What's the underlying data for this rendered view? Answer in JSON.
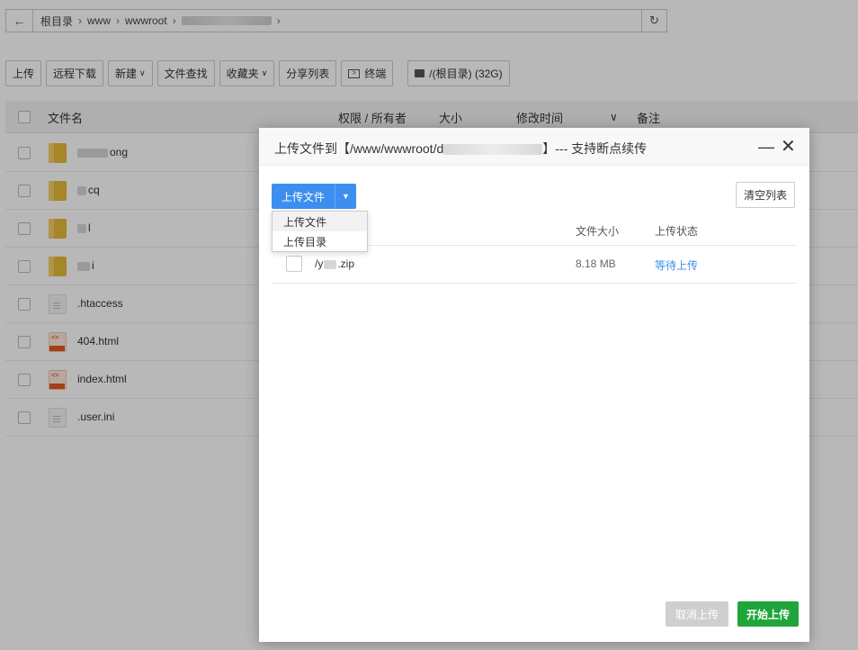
{
  "pathbar": {
    "crumbs": [
      "根目录",
      "www",
      "wwwroot"
    ],
    "sep": "›"
  },
  "toolbar": {
    "upload": "上传",
    "remote_download": "远程下载",
    "new": "新建",
    "file_search": "文件查找",
    "favorites": "收藏夹",
    "share_list": "分享列表",
    "terminal": "终端",
    "disk": "/(根目录) (32G)"
  },
  "table": {
    "col_name": "文件名",
    "col_perm": "权限 / 所有者",
    "col_size": "大小",
    "col_mtime": "修改时间",
    "col_note": "备注",
    "rows": [
      {
        "name": "ong",
        "type": "folder"
      },
      {
        "name": "cq",
        "type": "folder"
      },
      {
        "name": "l",
        "type": "folder"
      },
      {
        "name": "i",
        "type": "folder"
      },
      {
        "name": ".htaccess",
        "type": "file"
      },
      {
        "name": "404.html",
        "type": "html"
      },
      {
        "name": "index.html",
        "type": "html"
      },
      {
        "name": ".user.ini",
        "type": "file"
      }
    ]
  },
  "modal": {
    "title_prefix": "上传文件到【/www/wwwroot/d",
    "title_suffix": "】--- 支持断点续传",
    "min_icon": "—",
    "close_icon": "✕",
    "upload_file_btn": "上传文件",
    "clear_list_btn": "清空列表",
    "dropdown": [
      "上传文件",
      "上传目录"
    ],
    "col_size": "文件大小",
    "col_status": "上传状态",
    "file": {
      "name_prefix": "/y",
      "name_suffix": ".zip",
      "size": "8.18 MB",
      "status": "等待上传"
    },
    "cancel_btn": "取消上传",
    "start_btn": "开始上传"
  },
  "colors": {
    "primary": "#3d8fef",
    "success": "#20a53a",
    "folder": "#e8b93a"
  }
}
